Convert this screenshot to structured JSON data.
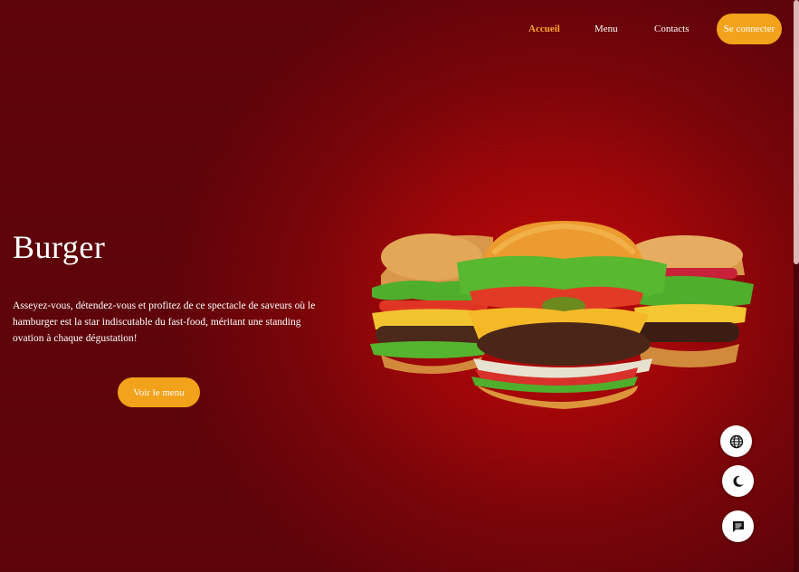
{
  "nav": {
    "items": [
      {
        "label": "Accueil",
        "active": true
      },
      {
        "label": "Menu",
        "active": false
      },
      {
        "label": "Contacts",
        "active": false
      }
    ],
    "login_label": "Se connecter"
  },
  "hero": {
    "title": "Burger",
    "description": "Asseyez-vous, détendez-vous et profitez de ce spectacle de saveurs où le hamburger est la star indiscutable du fast-food, méritant une standing ovation à chaque dégustation!",
    "cta_label": "Voir le menu"
  },
  "floating_buttons": [
    {
      "icon": "globe-icon"
    },
    {
      "icon": "moon-icon"
    },
    {
      "icon": "chat-icon"
    }
  ],
  "colors": {
    "accent": "#f2a21b",
    "active_link": "#f7a62a",
    "background": "#7b0509"
  }
}
